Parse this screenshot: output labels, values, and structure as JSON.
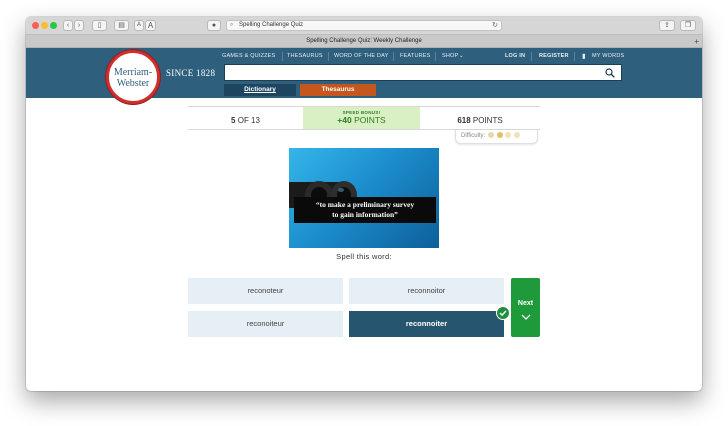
{
  "browser": {
    "url": "Spelling Challenge Quiz",
    "tab_title": "Spelling Challenge Quiz: Weekly Challenge",
    "font_small": "A",
    "font_large": "A"
  },
  "site": {
    "logo_line1": "Merriam-",
    "logo_line2": "Webster",
    "since": "SINCE 1828",
    "nav": [
      "GAMES & QUIZZES",
      "THESAURUS",
      "WORD OF THE DAY",
      "FEATURES",
      "SHOP"
    ],
    "login": "LOG IN",
    "register": "REGISTER",
    "my_words": "MY WORDS",
    "search_placeholder": "",
    "tab_dictionary": "Dictionary",
    "tab_thesaurus": "Thesaurus"
  },
  "quiz": {
    "question_num": "5",
    "question_of": " OF 13",
    "bonus_label": "SPEED BONUS!",
    "bonus_value": "+40",
    "bonus_unit": " POINTS",
    "points_value": "618",
    "points_unit": " POINTS",
    "difficulty_label": "Difficulty:",
    "clue_line1": "“to make a preliminary survey",
    "clue_line2": "to gain information”",
    "prompt": "Spell this word:",
    "options": [
      "reconoteur",
      "reconnoitor",
      "reconoiteur",
      "reconnoiter"
    ],
    "selected_index": 3,
    "next_label": "Next"
  },
  "colors": {
    "header": "#2e5f7d",
    "logo_ring": "#d02e2e",
    "thesaurus_tab": "#c5571e",
    "bonus_bg": "#d9efc4",
    "option_bg": "#e6eff5",
    "selected_option": "#26566f",
    "next_button": "#1e9a3a"
  }
}
